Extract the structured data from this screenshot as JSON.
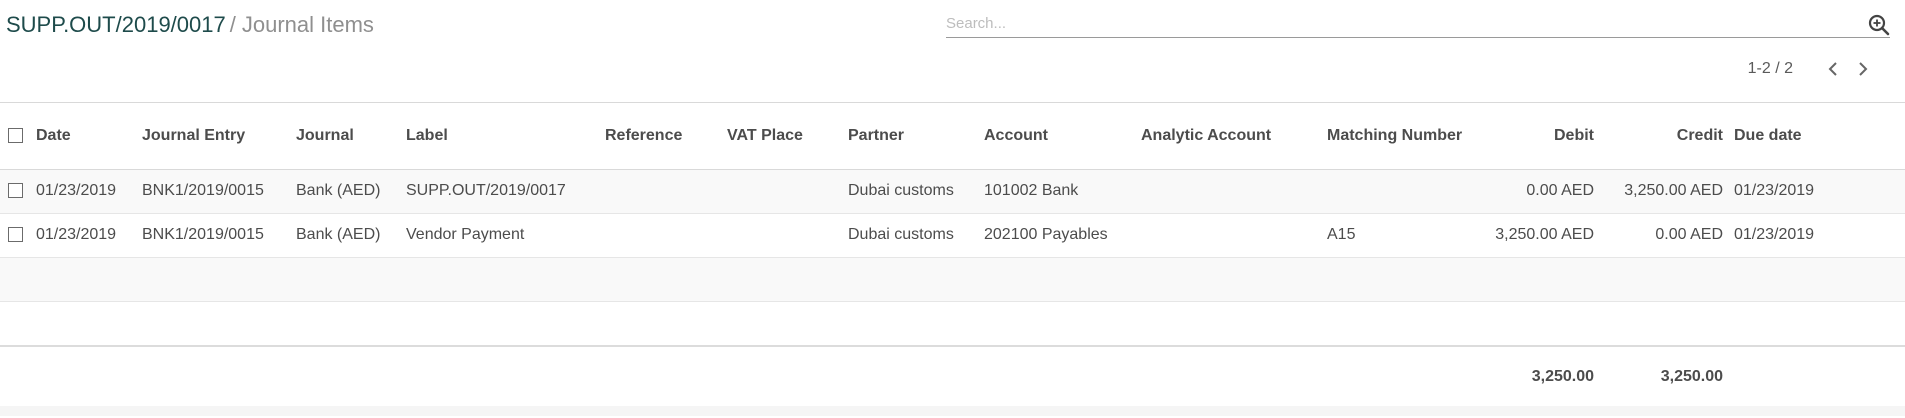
{
  "breadcrumb": {
    "parent": "SUPP.OUT/2019/0017",
    "separator": "/",
    "current": "Journal Items"
  },
  "search": {
    "placeholder": "Search...",
    "value": ""
  },
  "pager": {
    "value": "1-2 / 2",
    "prev_icon": "chevron-left-icon",
    "next_icon": "chevron-right-icon"
  },
  "table": {
    "columns": {
      "date": "Date",
      "journal_entry": "Journal Entry",
      "journal": "Journal",
      "label": "Label",
      "reference": "Reference",
      "vat_place": "VAT Place",
      "partner": "Partner",
      "account": "Account",
      "analytic_account": "Analytic Account",
      "matching_number": "Matching Number",
      "debit": "Debit",
      "credit": "Credit",
      "due_date": "Due date"
    },
    "rows": [
      {
        "date": "01/23/2019",
        "journal_entry": "BNK1/2019/0015",
        "journal": "Bank (AED)",
        "label": "SUPP.OUT/2019/0017",
        "reference": "",
        "vat_place": "",
        "partner": "Dubai customs",
        "account": "101002 Bank",
        "analytic_account": "",
        "matching_number": "",
        "debit": "0.00 AED",
        "credit": "3,250.00 AED",
        "due_date": "01/23/2019"
      },
      {
        "date": "01/23/2019",
        "journal_entry": "BNK1/2019/0015",
        "journal": "Bank (AED)",
        "label": "Vendor Payment",
        "reference": "",
        "vat_place": "",
        "partner": "Dubai customs",
        "account": "202100 Payables",
        "analytic_account": "",
        "matching_number": "A15",
        "debit": "3,250.00 AED",
        "credit": "0.00 AED",
        "due_date": "01/23/2019"
      }
    ],
    "totals": {
      "debit": "3,250.00",
      "credit": "3,250.00"
    }
  },
  "colors": {
    "breadcrumb_link": "#1e4b4b",
    "muted_text": "#8f8f8f",
    "body_text": "#4c4c4c",
    "row_stripe": "#f9f9f9",
    "border": "#d9d9d9"
  }
}
